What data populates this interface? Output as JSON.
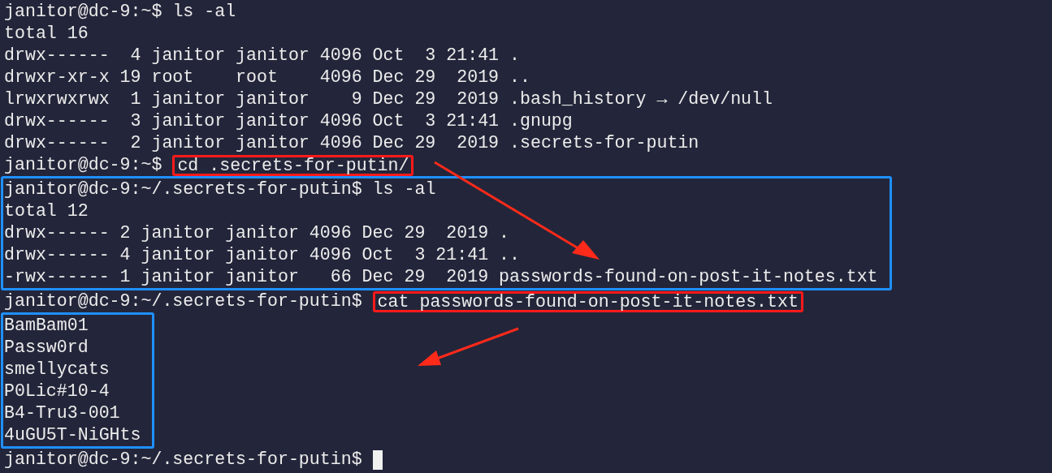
{
  "terminal": {
    "blocks": [
      {
        "framed": false,
        "lines": [
          {
            "kind": "prompt",
            "prompt": "janitor@dc-9:~$",
            "command": "ls -al",
            "command_framed": false
          },
          {
            "kind": "output",
            "text": "total 16"
          },
          {
            "kind": "output",
            "text": "drwx------  4 janitor janitor 4096 Oct  3 21:41 ."
          },
          {
            "kind": "output",
            "text": "drwxr-xr-x 19 root    root    4096 Dec 29  2019 .."
          },
          {
            "kind": "output",
            "text": "lrwxrwxrwx  1 janitor janitor    9 Dec 29  2019 .bash_history → /dev/null"
          },
          {
            "kind": "output",
            "text": "drwx------  3 janitor janitor 4096 Oct  3 21:41 .gnupg"
          },
          {
            "kind": "output",
            "text": "drwx------  2 janitor janitor 4096 Dec 29  2019 .secrets-for-putin"
          },
          {
            "kind": "prompt",
            "prompt": "janitor@dc-9:~$",
            "command": "cd .secrets-for-putin/",
            "command_framed": true
          }
        ]
      },
      {
        "framed": true,
        "lines": [
          {
            "kind": "prompt",
            "prompt": "janitor@dc-9:~/.secrets-for-putin$",
            "command": "ls -al",
            "command_framed": false
          },
          {
            "kind": "output",
            "text": "total 12"
          },
          {
            "kind": "output",
            "text": "drwx------ 2 janitor janitor 4096 Dec 29  2019 ."
          },
          {
            "kind": "output",
            "text": "drwx------ 4 janitor janitor 4096 Oct  3 21:41 .."
          },
          {
            "kind": "output",
            "text": "-rwx------ 1 janitor janitor   66 Dec 29  2019 passwords-found-on-post-it-notes.txt"
          }
        ]
      },
      {
        "framed": false,
        "lines": [
          {
            "kind": "prompt",
            "prompt": "janitor@dc-9:~/.secrets-for-putin$",
            "command": "cat passwords-found-on-post-it-notes.txt",
            "command_framed": true
          }
        ]
      },
      {
        "framed": true,
        "lines": [
          {
            "kind": "output",
            "text": "BamBam01"
          },
          {
            "kind": "output",
            "text": "Passw0rd"
          },
          {
            "kind": "output",
            "text": "smellycats"
          },
          {
            "kind": "output",
            "text": "P0Lic#10-4"
          },
          {
            "kind": "output",
            "text": "B4-Tru3-001"
          },
          {
            "kind": "output",
            "text": "4uGU5T-NiGHts"
          }
        ]
      },
      {
        "framed": false,
        "lines": [
          {
            "kind": "prompt",
            "prompt": "janitor@dc-9:~/.secrets-for-putin$",
            "cursor": true
          }
        ]
      }
    ]
  }
}
